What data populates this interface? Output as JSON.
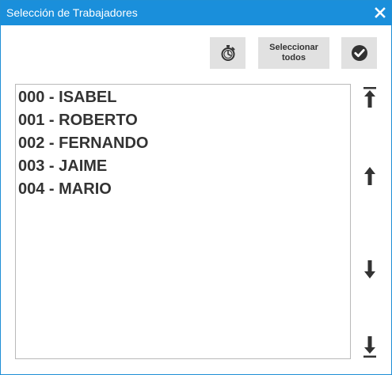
{
  "window": {
    "title": "Selección de Trabajadores",
    "close_symbol": "✕"
  },
  "toolbar": {
    "timer_icon": "stopwatch-icon",
    "select_all_label": "Seleccionar\ntodos",
    "confirm_icon": "check-circle-icon"
  },
  "workers": {
    "items": [
      {
        "label": "000 - ISABEL"
      },
      {
        "label": "001 - ROBERTO"
      },
      {
        "label": "002 - FERNANDO"
      },
      {
        "label": "003 - JAIME"
      },
      {
        "label": "004 - MARIO"
      }
    ]
  },
  "navigation": {
    "icons": [
      "go-top-icon",
      "arrow-up-icon",
      "arrow-down-icon",
      "go-bottom-icon"
    ]
  },
  "colors": {
    "title_bar": "#1a8fdb",
    "button_bg": "#e1e1e1",
    "text": "#333333"
  }
}
